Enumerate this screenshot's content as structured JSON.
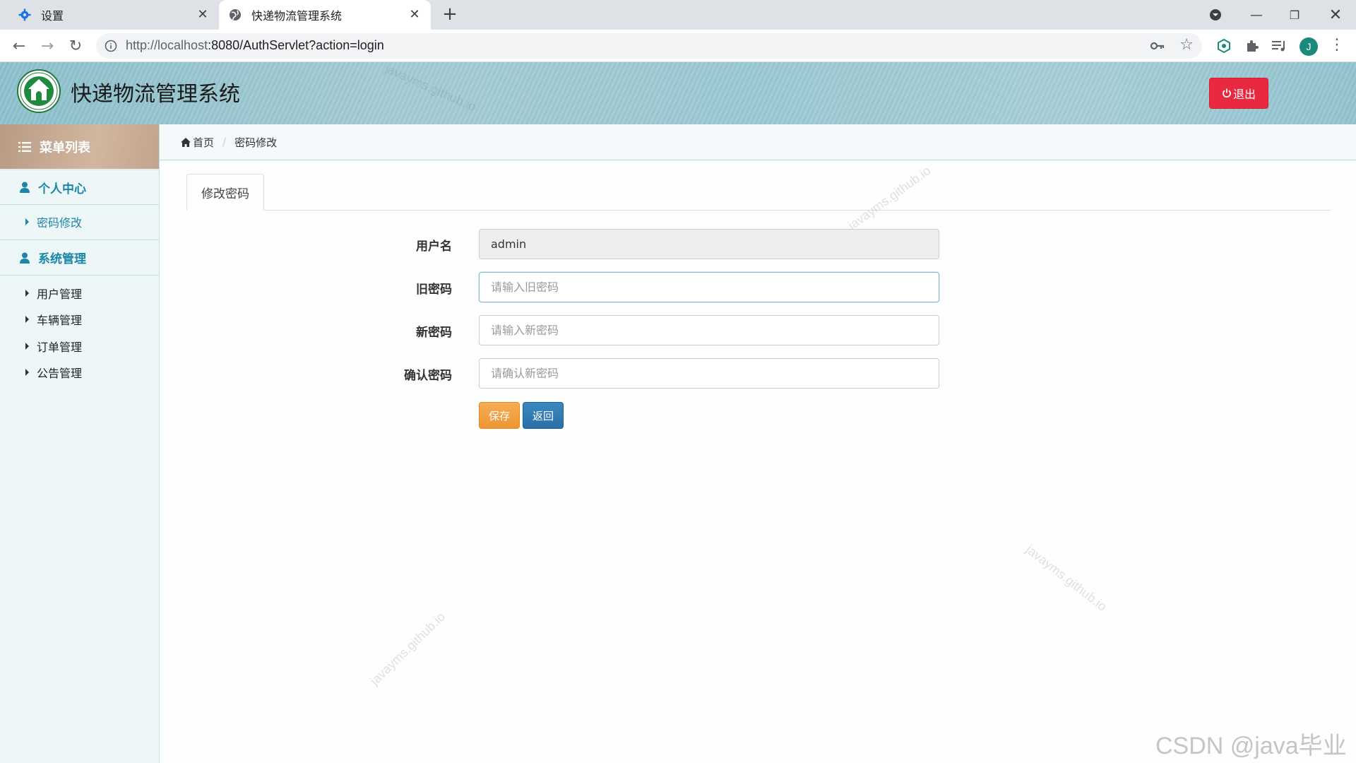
{
  "browser": {
    "tabs": [
      {
        "title": "设置",
        "icon": "gear-icon"
      },
      {
        "title": "快递物流管理系统",
        "icon": "globe-icon"
      }
    ],
    "url_host": "http://localhost",
    "url_path": ":8080/AuthServlet?action=login",
    "profile_initial": "J"
  },
  "header": {
    "title": "快递物流管理系统",
    "logout_label": "退出"
  },
  "sidebar": {
    "menu_title": "菜单列表",
    "groups": [
      {
        "label": "个人中心",
        "items": [
          {
            "label": "密码修改"
          }
        ]
      },
      {
        "label": "系统管理",
        "items": [
          {
            "label": "用户管理"
          },
          {
            "label": "车辆管理"
          },
          {
            "label": "订单管理"
          },
          {
            "label": "公告管理"
          }
        ]
      }
    ]
  },
  "breadcrumb": {
    "home": "首页",
    "current": "密码修改"
  },
  "content": {
    "tab_label": "修改密码",
    "fields": [
      {
        "label": "用户名",
        "value": "admin",
        "placeholder": ""
      },
      {
        "label": "旧密码",
        "value": "",
        "placeholder": "请输入旧密码"
      },
      {
        "label": "新密码",
        "value": "",
        "placeholder": "请输入新密码"
      },
      {
        "label": "确认密码",
        "value": "",
        "placeholder": "请确认新密码"
      }
    ],
    "save_label": "保存",
    "back_label": "返回"
  },
  "watermark_text": "javayms.github.io",
  "credit_text": "CSDN @java毕业",
  "colors": {
    "logout": "#e8293f",
    "save": "#f0a040",
    "back": "#2e77b0",
    "sidebar_accent": "#1c86a8"
  }
}
